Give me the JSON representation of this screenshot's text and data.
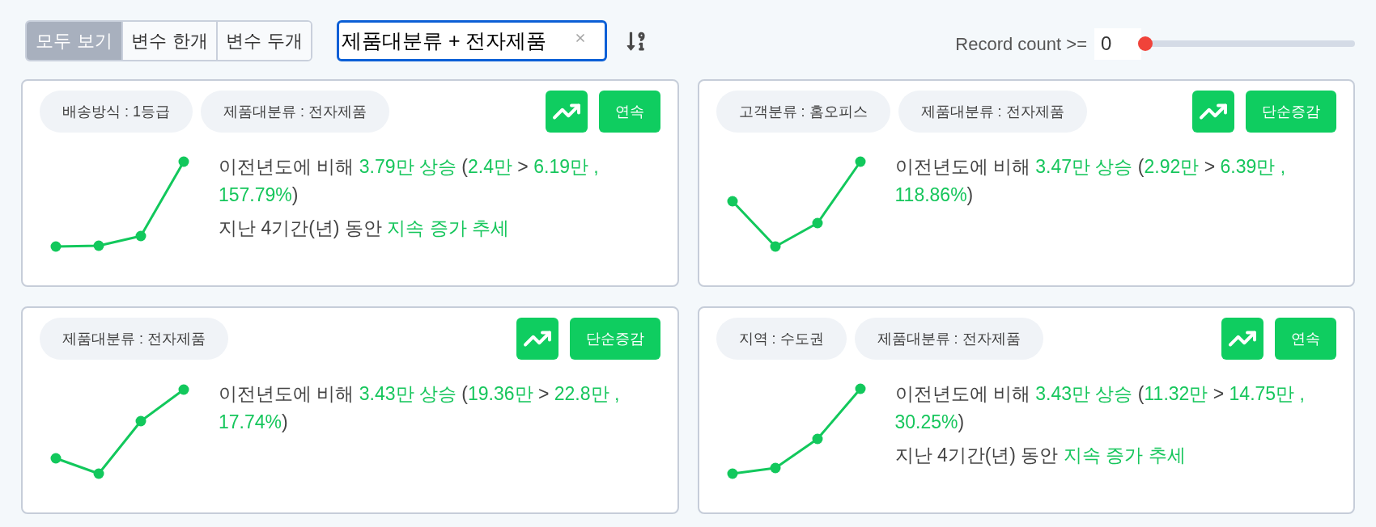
{
  "view_tabs": [
    {
      "label": "모두 보기",
      "selected": true
    },
    {
      "label": "변수 한개",
      "selected": false
    },
    {
      "label": "변수 두개",
      "selected": false
    }
  ],
  "search": {
    "value": "제품대분류 + 전자제품"
  },
  "record_count": {
    "label": "Record count >=",
    "value": "0",
    "level": 0
  },
  "cards": [
    {
      "filters": [
        "배송방식 : 1등급",
        "제품대분류 : 전자제품"
      ],
      "pattern": "연속",
      "summary": [
        {
          "text": "이전년도에 비해 ",
          "highlight": false
        },
        {
          "text": "3.79만 상승",
          "highlight": true
        },
        {
          "text": " (",
          "highlight": false
        },
        {
          "text": "2.4만",
          "highlight": true
        },
        {
          "text": " > ",
          "highlight": false
        },
        {
          "text": "6.19만 , 157.79%",
          "highlight": true
        },
        {
          "text": ")",
          "highlight": false
        }
      ],
      "trend_note": [
        {
          "text": "지난 4기간(년) 동안 ",
          "highlight": false
        },
        {
          "text": "지속 증가 추세",
          "highlight": true
        }
      ]
    },
    {
      "filters": [
        "고객분류 : 홈오피스",
        "제품대분류 : 전자제품"
      ],
      "pattern": "단순증감",
      "summary": [
        {
          "text": "이전년도에 비해 ",
          "highlight": false
        },
        {
          "text": "3.47만 상승",
          "highlight": true
        },
        {
          "text": " (",
          "highlight": false
        },
        {
          "text": "2.92만",
          "highlight": true
        },
        {
          "text": " > ",
          "highlight": false
        },
        {
          "text": "6.39만 , 118.86%",
          "highlight": true
        },
        {
          "text": ")",
          "highlight": false
        }
      ]
    },
    {
      "filters": [
        "제품대분류 : 전자제품"
      ],
      "pattern": "단순증감",
      "summary": [
        {
          "text": "이전년도에 비해 ",
          "highlight": false
        },
        {
          "text": "3.43만 상승",
          "highlight": true
        },
        {
          "text": " (",
          "highlight": false
        },
        {
          "text": "19.36만",
          "highlight": true
        },
        {
          "text": " > ",
          "highlight": false
        },
        {
          "text": "22.8만 , 17.74%",
          "highlight": true
        },
        {
          "text": ")",
          "highlight": false
        }
      ]
    },
    {
      "filters": [
        "지역 : 수도권",
        "제품대분류 : 전자제품"
      ],
      "pattern": "연속",
      "summary": [
        {
          "text": "이전년도에 비해 ",
          "highlight": false
        },
        {
          "text": "3.43만 상승",
          "highlight": true
        },
        {
          "text": " (",
          "highlight": false
        },
        {
          "text": "11.32만",
          "highlight": true
        },
        {
          "text": " > ",
          "highlight": false
        },
        {
          "text": "14.75만 , 30.25%",
          "highlight": true
        },
        {
          "text": ")",
          "highlight": false
        }
      ],
      "trend_note": [
        {
          "text": "지난 4기간(년) 동안 ",
          "highlight": false
        },
        {
          "text": "지속 증가 추세",
          "highlight": true
        }
      ]
    }
  ]
}
